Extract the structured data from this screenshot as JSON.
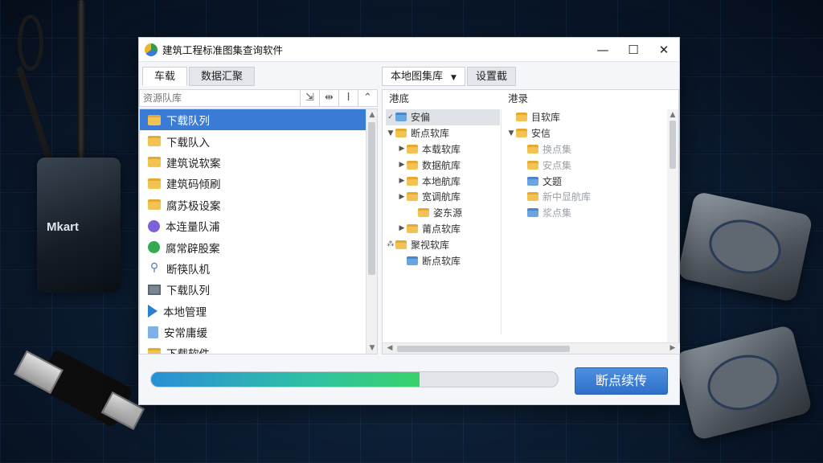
{
  "background": {
    "brand_text": "Mkart"
  },
  "window": {
    "title": "建筑工程标准图集查询软件"
  },
  "left_panel": {
    "tabs": [
      {
        "label": "车载"
      },
      {
        "label": "数据汇聚"
      }
    ],
    "search_placeholder": "资源队库",
    "toolbar_buttons": [
      "⇲",
      "⇹",
      "I",
      "⌃"
    ],
    "items": [
      {
        "label": "下载队列",
        "icon": "folder-icon",
        "selected": true
      },
      {
        "label": "下载队入",
        "icon": "folder-icon",
        "selected": false
      },
      {
        "label": "建筑说软案",
        "icon": "folder-icon",
        "selected": false
      },
      {
        "label": "建筑码倾刷",
        "icon": "folder-icon",
        "selected": false
      },
      {
        "label": "腐苏极设案",
        "icon": "folder-icon",
        "selected": false
      },
      {
        "label": "本连量队浦",
        "icon": "purple-circle-icon",
        "selected": false
      },
      {
        "label": "腐常辟股案",
        "icon": "green-circle-icon",
        "selected": false
      },
      {
        "label": "断筷队机",
        "icon": "network-icon",
        "selected": false
      },
      {
        "label": "下载队列",
        "icon": "monitor-icon",
        "selected": false
      },
      {
        "label": "本地管理",
        "icon": "play-icon",
        "selected": false
      },
      {
        "label": "安常庸缓",
        "icon": "document-icon",
        "selected": false
      },
      {
        "label": "下载软件",
        "icon": "folder-icon",
        "selected": false
      }
    ]
  },
  "right_panel": {
    "tabs": [
      {
        "label": "本地图集库",
        "has_dropdown": true
      },
      {
        "label": "设置截"
      }
    ],
    "col1_header": "港底",
    "col2_header": "港录",
    "tree_left": [
      {
        "label": "安偏",
        "level": 0,
        "arrow": "✓",
        "icon": "folder-blue-icon",
        "highlight": true
      },
      {
        "label": "断点软库",
        "level": 0,
        "arrow": "▼",
        "icon": "folder-icon",
        "highlight": false
      },
      {
        "label": "本载软库",
        "level": 1,
        "arrow": "▶",
        "icon": "folder-icon",
        "highlight": false
      },
      {
        "label": "数据航库",
        "level": 1,
        "arrow": "▶",
        "icon": "folder-icon",
        "highlight": false
      },
      {
        "label": "本地航库",
        "level": 1,
        "arrow": "▶",
        "icon": "folder-icon",
        "highlight": false
      },
      {
        "label": "宽调航库",
        "level": 1,
        "arrow": "▶",
        "icon": "folder-icon",
        "highlight": false
      },
      {
        "label": "姿东源",
        "level": 2,
        "arrow": "",
        "icon": "folder-icon",
        "highlight": false
      },
      {
        "label": "莆点软库",
        "level": 1,
        "arrow": "▶",
        "icon": "folder-icon",
        "highlight": false
      },
      {
        "label": "聚视软库",
        "level": 0,
        "arrow": "⁂",
        "icon": "folder-icon",
        "highlight": false
      },
      {
        "label": "断点软库",
        "level": 1,
        "arrow": "",
        "icon": "folder-blue-icon",
        "highlight": false
      }
    ],
    "tree_right": [
      {
        "label": "目软库",
        "level": 0,
        "arrow": "",
        "icon": "folder-icon",
        "faded": false
      },
      {
        "label": "安信",
        "level": 0,
        "arrow": "▼",
        "icon": "folder-icon",
        "faded": false
      },
      {
        "label": "换点集",
        "level": 1,
        "arrow": "",
        "icon": "folder-icon",
        "faded": true
      },
      {
        "label": "安点集",
        "level": 1,
        "arrow": "",
        "icon": "folder-icon",
        "faded": true
      },
      {
        "label": "文题",
        "level": 1,
        "arrow": "",
        "icon": "folder-blue-icon",
        "faded": false
      },
      {
        "label": "新中显航库",
        "level": 1,
        "arrow": "",
        "icon": "folder-icon",
        "faded": true
      },
      {
        "label": "浆点集",
        "level": 1,
        "arrow": "",
        "icon": "folder-blue-icon",
        "faded": true
      }
    ]
  },
  "footer": {
    "progress": 0.66,
    "resume_label": "断点续传"
  }
}
